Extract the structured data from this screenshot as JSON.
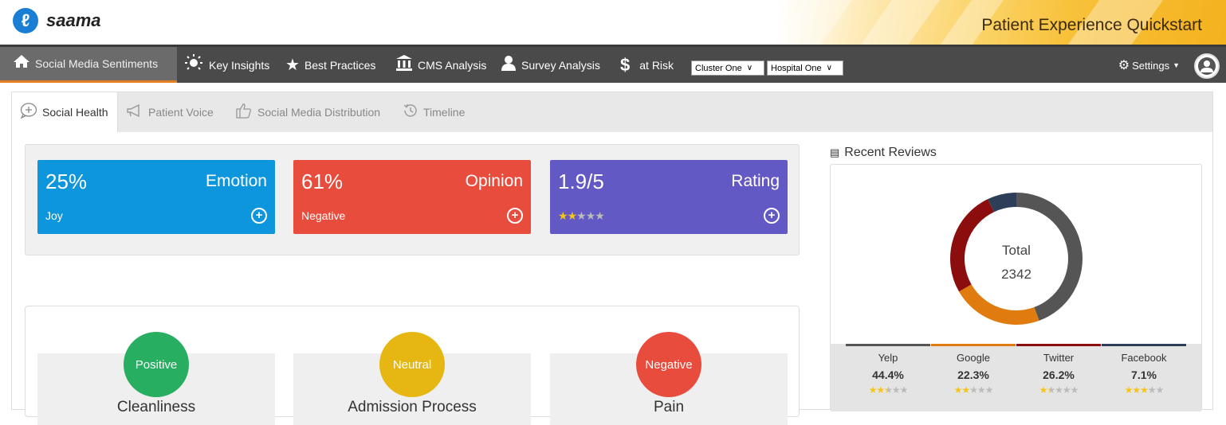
{
  "header": {
    "logo_text": "saama",
    "app_title": "Patient Experience Quickstart"
  },
  "nav": {
    "items": [
      {
        "label": "Social Media Sentiments",
        "icon": "home-icon"
      },
      {
        "label": "Key Insights",
        "icon": "lightbulb-icon"
      },
      {
        "label": "Best Practices",
        "icon": "star-icon"
      },
      {
        "label": "CMS Analysis",
        "icon": "bank-icon"
      },
      {
        "label": "Survey Analysis",
        "icon": "user-icon"
      },
      {
        "label": "at Risk",
        "icon": "dollar-icon"
      }
    ],
    "cluster_select": "Cluster One",
    "hospital_select": "Hospital One",
    "settings_label": "Settings"
  },
  "tabs": [
    {
      "label": "Social Health",
      "icon": "chat-plus-icon"
    },
    {
      "label": "Patient Voice",
      "icon": "megaphone-icon"
    },
    {
      "label": "Social Media Distribution",
      "icon": "thumbs-up-icon"
    },
    {
      "label": "Timeline",
      "icon": "history-icon"
    }
  ],
  "kpis": [
    {
      "value": "25%",
      "title": "Emotion",
      "sub": "Joy",
      "color": "#0d96db"
    },
    {
      "value": "61%",
      "title": "Opinion",
      "sub": "Negative",
      "color": "#e84c3d"
    },
    {
      "value": "1.9/5",
      "title": "Rating",
      "stars": 2,
      "color": "#6359c4"
    }
  ],
  "sentiments": [
    {
      "badge": "Positive",
      "label": "Cleanliness",
      "color": "#27ae60"
    },
    {
      "badge": "Neutral",
      "label": "Admission Process",
      "color": "#e6b712"
    },
    {
      "badge": "Negative",
      "label": "Pain",
      "color": "#e84c3d"
    }
  ],
  "recent_reviews": {
    "title": "Recent Reviews",
    "total_label": "Total",
    "total": "2342",
    "sources": [
      {
        "name": "Yelp",
        "pct": "44.4%",
        "stars": 2.5,
        "color": "#555555"
      },
      {
        "name": "Google",
        "pct": "22.3%",
        "stars": 2,
        "color": "#e07b10"
      },
      {
        "name": "Twitter",
        "pct": "26.2%",
        "stars": 1.5,
        "color": "#8b0d0d"
      },
      {
        "name": "Facebook",
        "pct": "7.1%",
        "stars": 3,
        "color": "#2c3e58"
      }
    ]
  }
}
